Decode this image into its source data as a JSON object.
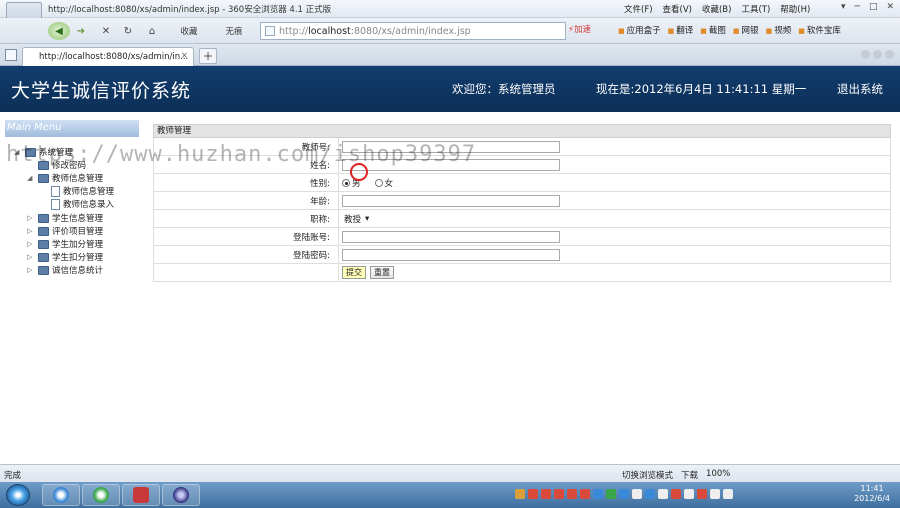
{
  "browser": {
    "window_title": "http://localhost:8080/xs/admin/index.jsp - 360安全浏览器 4.1 正式版",
    "menu": [
      "文件(F)",
      "查看(V)",
      "收藏(B)",
      "工具(T)",
      "帮助(H)"
    ],
    "window_buttons": [
      "▾",
      "─",
      "□",
      "✕"
    ],
    "nav": {
      "back": "◀",
      "forward": "➜",
      "stop": "✕",
      "refresh": "↻",
      "home": "⌂",
      "favorites": "收藏",
      "mode": "无痕"
    },
    "url": {
      "prefix": "http://",
      "host": "localhost",
      "rest": ":8080/xs/admin/index.jsp"
    },
    "speedup": "⚡加速",
    "tools": [
      "应用盒子",
      "翻译",
      "截图",
      "网银",
      "视频",
      "软件宝库"
    ],
    "tab_title": "http://localhost:8080/xs/admin/in...",
    "tab_close": "×",
    "new_tab": "+",
    "status": {
      "left": "完成",
      "right": [
        "切换浏览模式",
        "下载",
        "100%"
      ]
    }
  },
  "app": {
    "title": "大学生诚信评价系统",
    "welcome": "欢迎您：系统管理员",
    "now": "现在是:2012年6月4日  11:41:11 星期一",
    "logout": "退出系统"
  },
  "sidebar": {
    "heading": "Main Menu",
    "items": [
      {
        "label": "系统管理",
        "level": 0,
        "icon": "folder",
        "arrow": "◢"
      },
      {
        "label": "修改密码",
        "level": 1,
        "icon": "folder",
        "arrow": ""
      },
      {
        "label": "教师信息管理",
        "level": 1,
        "icon": "folder",
        "arrow": "◢"
      },
      {
        "label": "教师信息管理",
        "level": 2,
        "icon": "doc",
        "arrow": ""
      },
      {
        "label": "教师信息录入",
        "level": 2,
        "icon": "doc",
        "arrow": ""
      },
      {
        "label": "学生信息管理",
        "level": 1,
        "icon": "folder",
        "arrow": "▷"
      },
      {
        "label": "评价项目管理",
        "level": 1,
        "icon": "folder",
        "arrow": "▷"
      },
      {
        "label": "学生加分管理",
        "level": 1,
        "icon": "folder",
        "arrow": "▷"
      },
      {
        "label": "学生扣分管理",
        "level": 1,
        "icon": "folder",
        "arrow": "▷"
      },
      {
        "label": "诚信信息统计",
        "level": 1,
        "icon": "folder",
        "arrow": "▷"
      }
    ]
  },
  "form": {
    "panel_title": "教师管理",
    "fields": {
      "teacher_no": {
        "label": "教师号:",
        "value": ""
      },
      "name": {
        "label": "姓名:",
        "value": ""
      },
      "gender": {
        "label": "性别:",
        "options": [
          "男",
          "女"
        ],
        "selected": "男"
      },
      "age": {
        "label": "年龄:",
        "value": ""
      },
      "title": {
        "label": "职称:",
        "value": "教授",
        "caret": "▾"
      },
      "login_account": {
        "label": "登陆账号:",
        "value": ""
      },
      "login_password": {
        "label": "登陆密码:",
        "value": ""
      }
    },
    "submit": "提交",
    "reset": "重置"
  },
  "watermark": "https://www.huzhan.com/ishop39397",
  "taskbar": {
    "clock_time": "11:41",
    "clock_date": "2012/6/4"
  },
  "colors": {
    "header_bg": "#123d6e",
    "menu_head": "#9fbbdc",
    "submit_bg": "#ffffb8",
    "taskbar": "#3f6f9f"
  }
}
